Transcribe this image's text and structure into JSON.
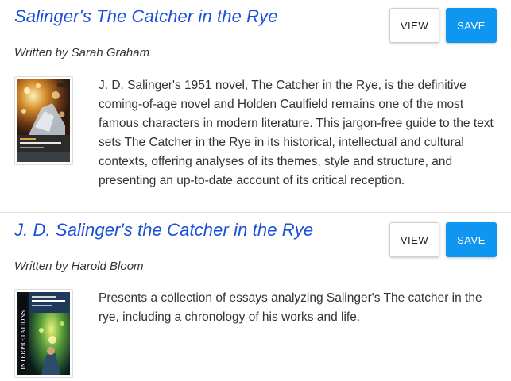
{
  "results": [
    {
      "title": "Salinger's The Catcher in the Rye",
      "author": "Written by Sarah Graham",
      "description": "J. D. Salinger's 1951 novel, The Catcher in the Rye, is the definitive coming-of-age novel and Holden Caulfield remains one of the most famous characters in modern literature. This jargon-free guide to the text sets The Catcher in the Rye in its historical, intellectual and cultural contexts, offering analyses of its themes, style and structure, and presenting an up-to-date account of its critical reception.",
      "view_label": "VIEW",
      "save_label": "SAVE",
      "cover": {
        "title_text": "The Catcher in the Rye",
        "author_text": "Sarah Graham",
        "series_text": "Salinger's"
      }
    },
    {
      "title": "J. D. Salinger's the Catcher in the Rye",
      "author": "Written by Harold Bloom",
      "description": "Presents a collection of essays analyzing Salinger's The catcher in the rye, including a chronology of his works and life.",
      "view_label": "VIEW",
      "save_label": "SAVE",
      "cover": {
        "series_text": "INTERPRETATIONS",
        "title_text": "J. D. Salinger's The Catcher in the Rye"
      }
    }
  ],
  "colors": {
    "title_link": "#1a4fd8",
    "save_button": "#0f96f0",
    "divider": "#e2e2e2"
  }
}
